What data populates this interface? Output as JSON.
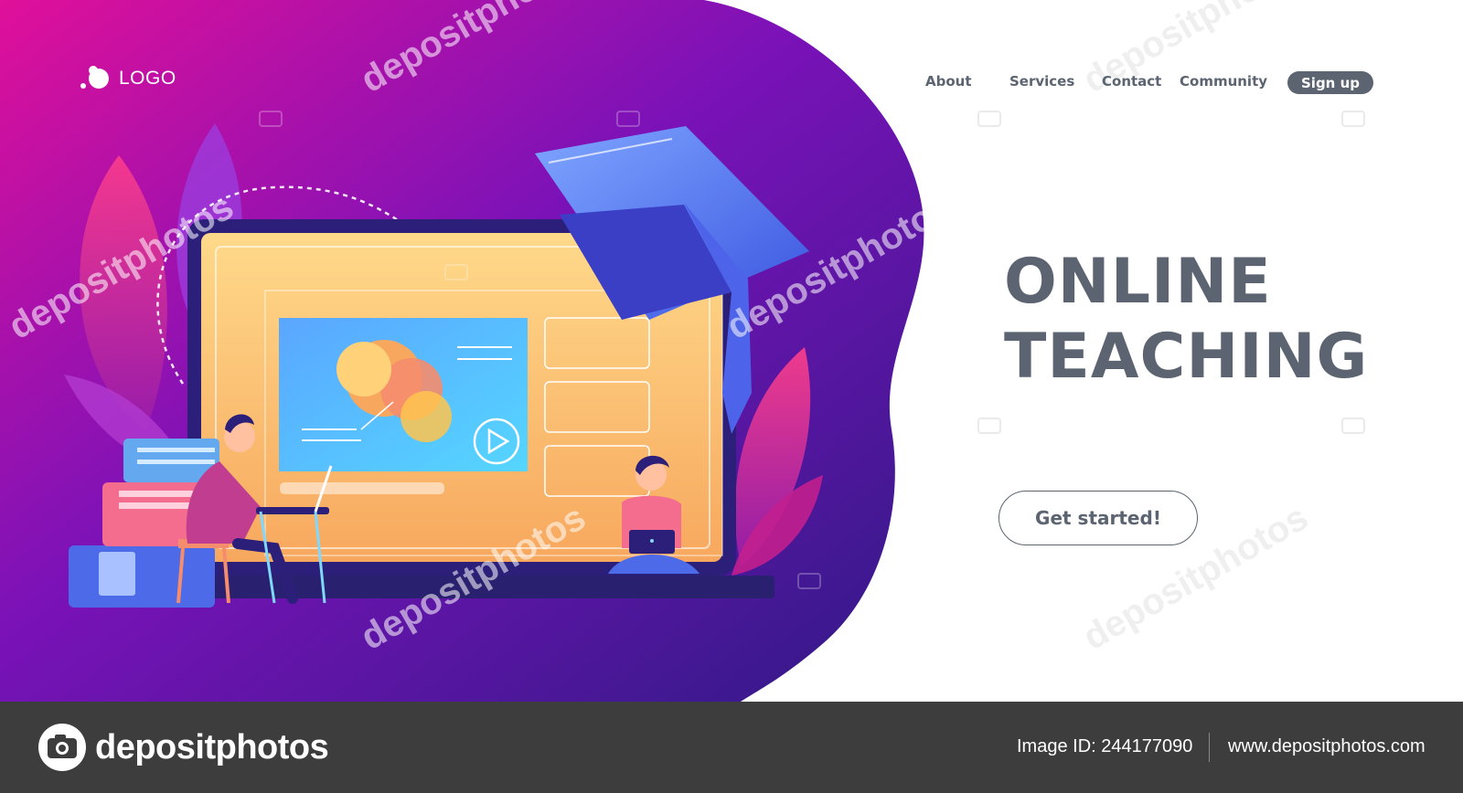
{
  "logo": {
    "text": "LOGO"
  },
  "nav": {
    "items": [
      "About",
      "Services",
      "Contact",
      "Community"
    ],
    "signup": "Sign up"
  },
  "hero": {
    "title_line1": "ONLINE",
    "title_line2": "TEACHING",
    "cta": "Get started!"
  },
  "watermark": {
    "text": "depositphotos"
  },
  "footer": {
    "brand": "depositphotos",
    "image_id": "Image ID: 244177090",
    "url": "www.depositphotos.com"
  },
  "colors": {
    "text_gray": "#5b6470",
    "blob_pink": "#e0109a",
    "blob_purple": "#7a12b8",
    "blob_deep": "#3b1a8c",
    "footer_bg": "#3d3d3d"
  },
  "icons": [
    "logo-dot-icon",
    "graduation-cap-icon",
    "play-icon",
    "laptop-icon",
    "camera-icon"
  ]
}
